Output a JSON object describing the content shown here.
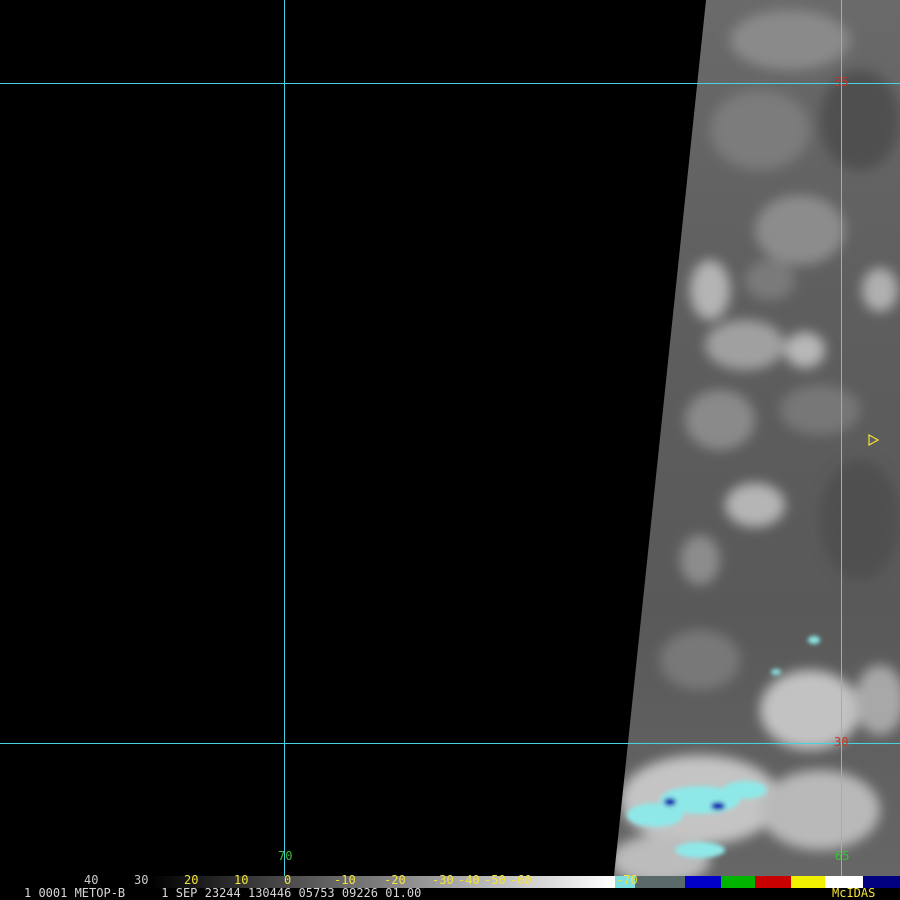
{
  "satellite_image": {
    "grid_lines": {
      "latitudes": [
        "35",
        "30"
      ],
      "longitudes": [
        "70",
        "65"
      ]
    },
    "colorbar": {
      "tick_labels": [
        "40",
        "30",
        "20",
        "10",
        "0",
        "-10",
        "-20",
        "-30",
        "-40",
        "-50",
        "-60",
        "-70"
      ],
      "colors": [
        "#000000",
        "#2b2b2b",
        "#555555",
        "#808080",
        "#aaaaaa",
        "#d5d5d5",
        "#ffffff",
        "#7fe0e0",
        "#0000c8",
        "#00b400",
        "#c80000",
        "#f0f000",
        "#ffffff",
        "#000080"
      ]
    },
    "info_line": "1 0001 METOP-B     1 SEP 23244 130446 05753 09226 01.00",
    "software": "McIDAS",
    "marker_icon": "triangle-marker-icon",
    "colors": {
      "grid": "#48d1e0",
      "latitude_label": "#c0392b",
      "longitude_label": "#3fbf3f",
      "colorbar_label": "#f2e33a",
      "background": "#000000"
    }
  }
}
